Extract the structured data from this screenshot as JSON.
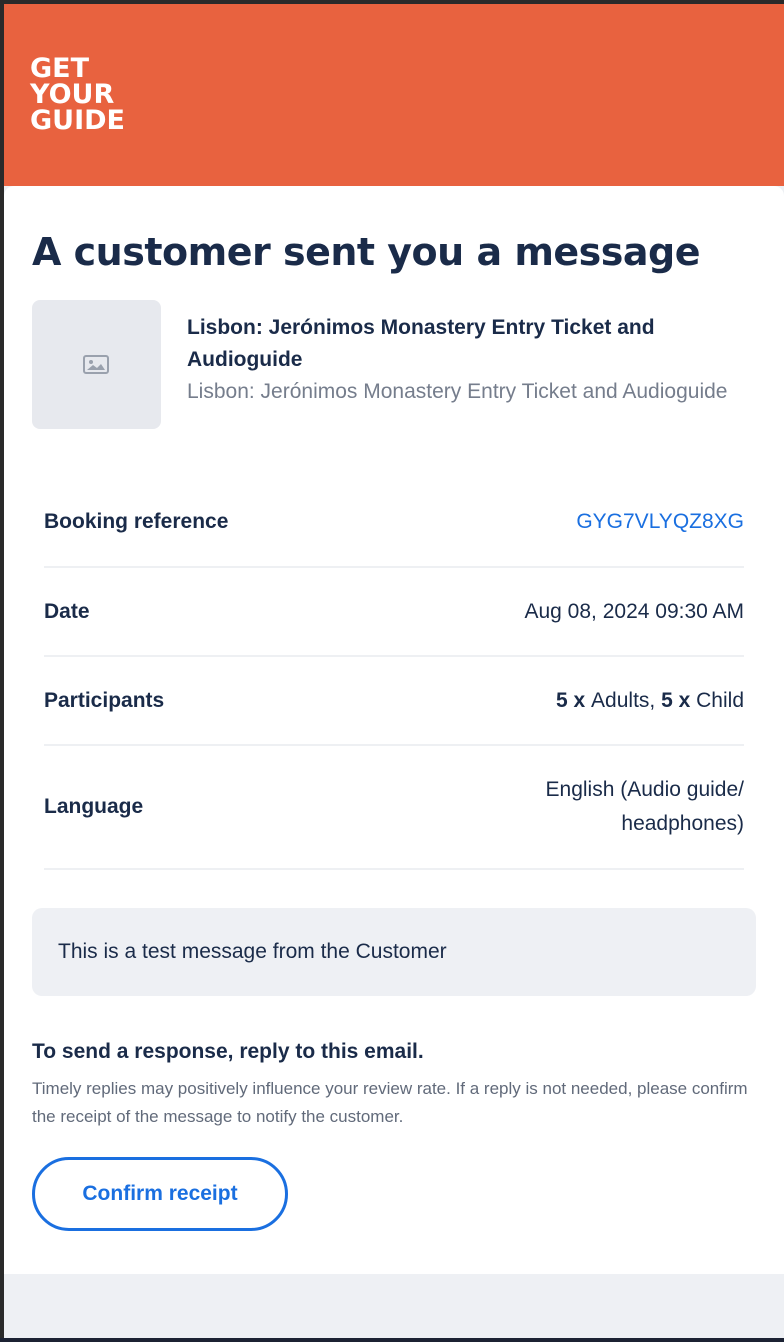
{
  "brand": {
    "logo_lines": [
      "GET",
      "YOUR",
      "GUIDE"
    ],
    "header_color": "#e8623f"
  },
  "email": {
    "title": "A customer sent you a message",
    "product": {
      "image_icon": "image-placeholder-icon",
      "title": "Lisbon: Jerónimos Monastery Entry Ticket and Audioguide",
      "subtitle": "Lisbon: Jerónimos Monastery Entry Ticket and Audioguide"
    },
    "details": [
      {
        "label": "Booking reference",
        "value": "GYG7VLYQZ8XG"
      },
      {
        "label": "Date",
        "value": "Aug 08, 2024 09:30 AM"
      },
      {
        "label": "Participants",
        "adults_count": "5",
        "adults_sep": " x ",
        "adults_label": "Adults, ",
        "child_count": "5",
        "child_sep": " x ",
        "child_label": "Child"
      },
      {
        "label": "Language",
        "value": "English (Audio guide/ headphones)"
      }
    ],
    "message": "This is a test message from the Customer",
    "reply_title": "To send a response, reply to this email.",
    "reply_note": "Timely replies may positively influence your review rate. If a reply is not needed, please confirm the receipt of the message to notify the customer.",
    "confirm_label": "Confirm receipt"
  },
  "colors": {
    "accent": "#1a6fe0",
    "text": "#1a2b49",
    "muted": "#757d8c"
  }
}
